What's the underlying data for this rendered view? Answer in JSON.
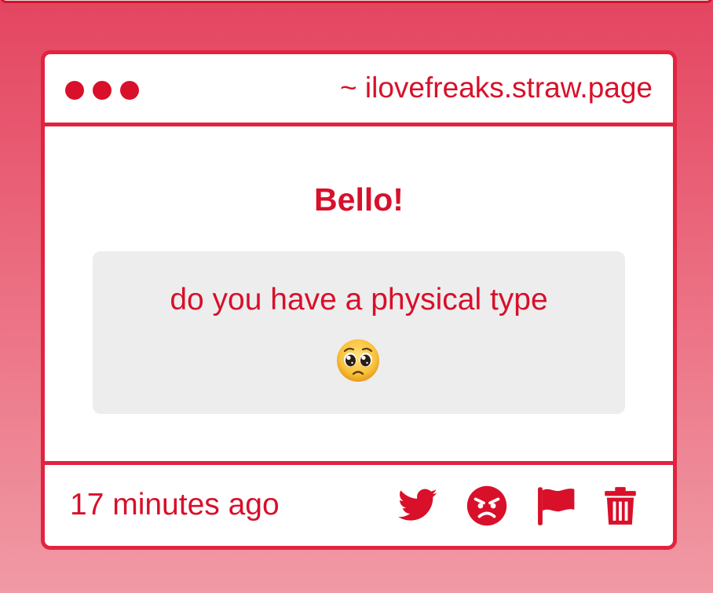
{
  "window": {
    "url": "~ ilovefreaks.straw.page"
  },
  "message": {
    "greeting": "Bello!",
    "question": "do you have a physical type",
    "emoji": "pleading-face"
  },
  "footer": {
    "timestamp": "17 minutes ago",
    "actions": [
      "twitter-icon",
      "angry-face-icon",
      "flag-icon",
      "trash-icon"
    ]
  },
  "colors": {
    "accent": "#d8102a",
    "border": "#e2233f",
    "bubble": "#ededee",
    "background_top": "#e44560",
    "background_bottom": "#f09aa5"
  }
}
